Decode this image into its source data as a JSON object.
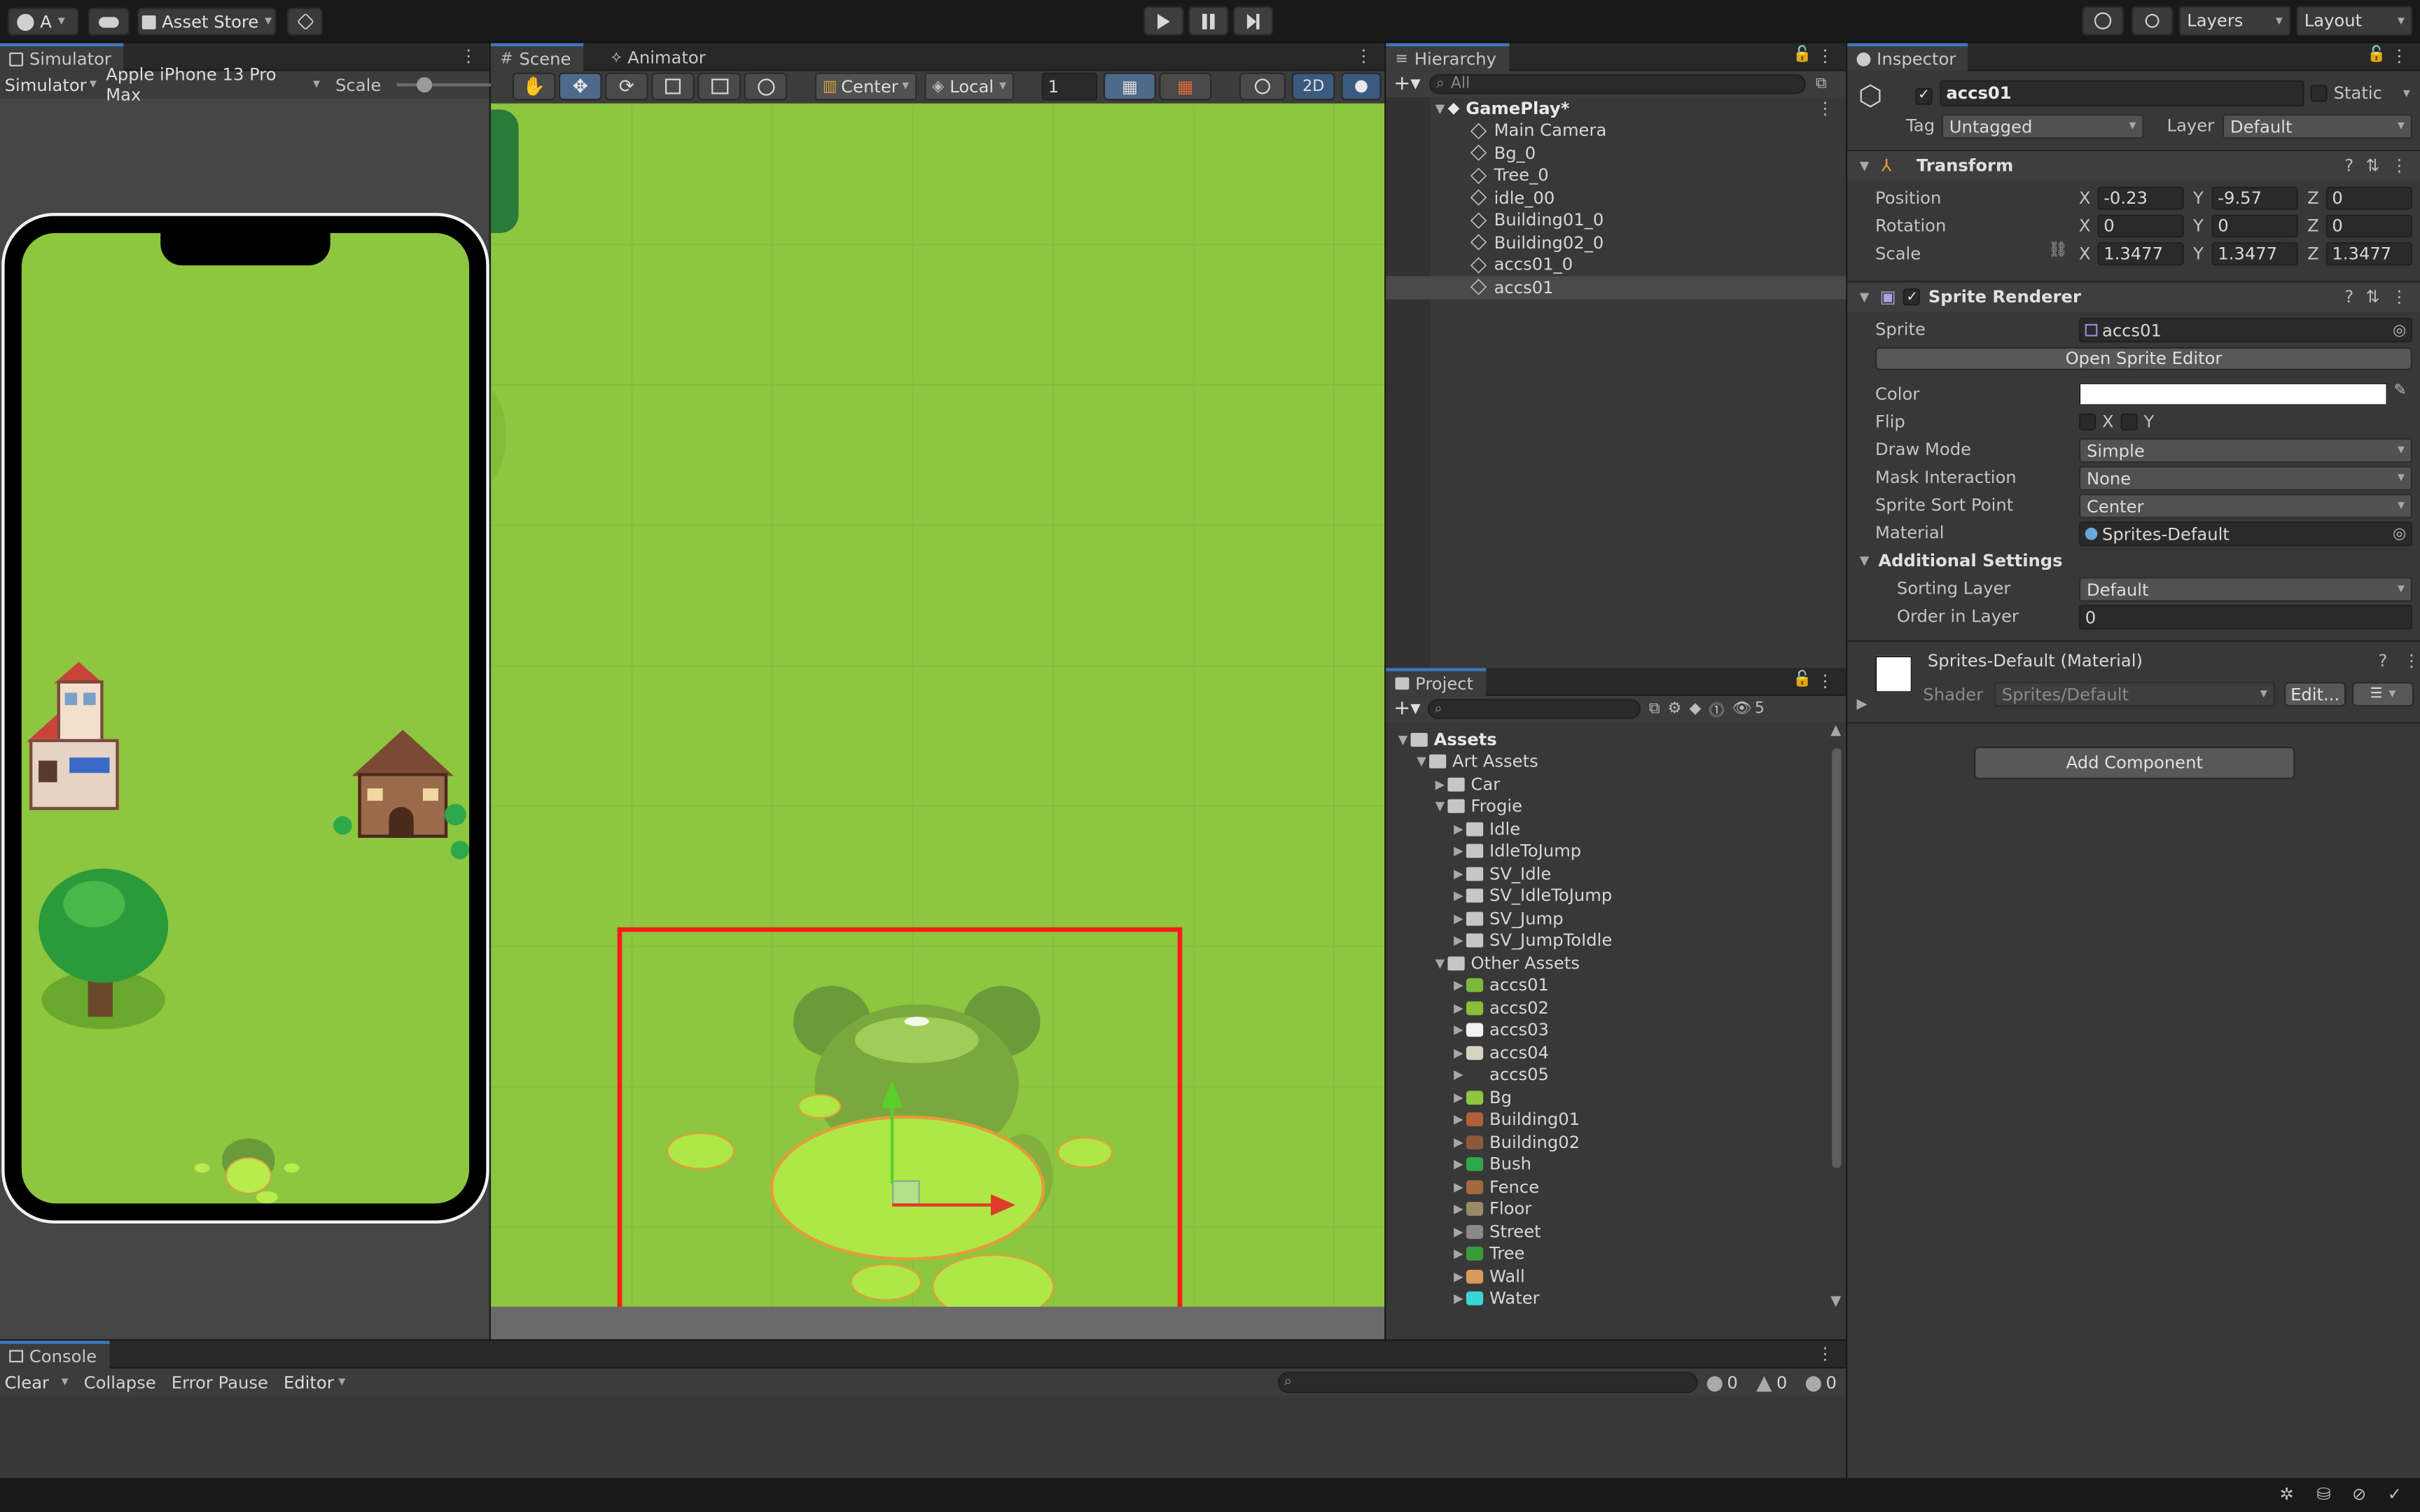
{
  "toolbar": {
    "account_label": "A",
    "asset_store_label": "Asset Store",
    "layers_label": "Layers",
    "layout_label": "Layout"
  },
  "simulator": {
    "tab_label": "Simulator",
    "mode_label": "Simulator",
    "device_label": "Apple iPhone 13 Pro Max",
    "scale_label": "Scale"
  },
  "scene": {
    "tab_scene": "Scene",
    "tab_animator": "Animator",
    "pivot_label": "Center",
    "space_label": "Local",
    "grid_value": "1",
    "mode_2d": "2D"
  },
  "hierarchy": {
    "tab_label": "Hierarchy",
    "search_placeholder": "All",
    "root": "GamePlay*",
    "items": [
      "Main Camera",
      "Bg_0",
      "Tree_0",
      "idle_00",
      "Building01_0",
      "Building02_0",
      "accs01_0",
      "accs01"
    ],
    "selected_index": 7
  },
  "project": {
    "tab_label": "Project",
    "hidden_count": "5",
    "assets_label": "Assets",
    "art_assets_label": "Art Assets",
    "car_label": "Car",
    "frogie_label": "Frogie",
    "frogie_children": [
      "Idle",
      "IdleToJump",
      "SV_Idle",
      "SV_IdleToJump",
      "SV_Jump",
      "SV_JumpToIdle"
    ],
    "other_assets_label": "Other Assets",
    "other_children": [
      {
        "name": "accs01",
        "icon": "sprite-accs01",
        "color": "#7bb83c"
      },
      {
        "name": "accs02",
        "icon": "sprite-accs02",
        "color": "#8dbb3a"
      },
      {
        "name": "accs03",
        "icon": "sprite-accs03",
        "color": "#f2f2f2"
      },
      {
        "name": "accs04",
        "icon": "sprite-accs04",
        "color": "#d8d2c2"
      },
      {
        "name": "accs05",
        "icon": "sprite-accs05",
        "color": "#383838"
      },
      {
        "name": "Bg",
        "icon": "sprite-bg",
        "color": "#8dc63f"
      },
      {
        "name": "Building01",
        "icon": "sprite-building01",
        "color": "#b0603a"
      },
      {
        "name": "Building02",
        "icon": "sprite-building02",
        "color": "#8a5a3a"
      },
      {
        "name": "Bush",
        "icon": "sprite-bush",
        "color": "#2ea84a"
      },
      {
        "name": "Fence",
        "icon": "sprite-fence",
        "color": "#a46a3c"
      },
      {
        "name": "Floor",
        "icon": "sprite-floor",
        "color": "#9a8a6a"
      },
      {
        "name": "Street",
        "icon": "sprite-street",
        "color": "#8a8a8a"
      },
      {
        "name": "Tree",
        "icon": "sprite-tree",
        "color": "#3a9a3a"
      },
      {
        "name": "Wall",
        "icon": "sprite-wall",
        "color": "#d89a5a"
      },
      {
        "name": "Water",
        "icon": "sprite-water",
        "color": "#3ad6d6"
      }
    ]
  },
  "inspector": {
    "tab_label": "Inspector",
    "object_name": "accs01",
    "static_label": "Static",
    "tag_label": "Tag",
    "tag_value": "Untagged",
    "layer_label": "Layer",
    "layer_value": "Default",
    "transform": {
      "title": "Transform",
      "position_label": "Position",
      "rotation_label": "Rotation",
      "scale_label": "Scale",
      "position": {
        "x": "-0.23",
        "y": "-9.57",
        "z": "0"
      },
      "rotation": {
        "x": "0",
        "y": "0",
        "z": "0"
      },
      "scale": {
        "x": "1.3477",
        "y": "1.3477",
        "z": "1.3477"
      }
    },
    "sprite_renderer": {
      "title": "Sprite Renderer",
      "sprite_label": "Sprite",
      "sprite_value": "accs01",
      "open_editor": "Open Sprite Editor",
      "color_label": "Color",
      "flip_label": "Flip",
      "flip_x": "X",
      "flip_y": "Y",
      "draw_mode_label": "Draw Mode",
      "draw_mode_value": "Simple",
      "mask_label": "Mask Interaction",
      "mask_value": "None",
      "sort_point_label": "Sprite Sort Point",
      "sort_point_value": "Center",
      "material_label": "Material",
      "material_value": "Sprites-Default",
      "additional_label": "Additional Settings",
      "sorting_layer_label": "Sorting Layer",
      "sorting_layer_value": "Default",
      "order_label": "Order in Layer",
      "order_value": "0"
    },
    "material": {
      "title": "Sprites-Default (Material)",
      "shader_label": "Shader",
      "shader_value": "Sprites/Default",
      "edit_label": "Edit..."
    },
    "add_component": "Add Component"
  },
  "console": {
    "tab_label": "Console",
    "clear_label": "Clear",
    "collapse_label": "Collapse",
    "error_pause_label": "Error Pause",
    "editor_label": "Editor",
    "log_count": "0",
    "warn_count": "0",
    "error_count": "0"
  },
  "colors": {
    "grass": "#8dc63f",
    "selection_rect": "#ff1a1a",
    "accent": "#3a79bb"
  }
}
